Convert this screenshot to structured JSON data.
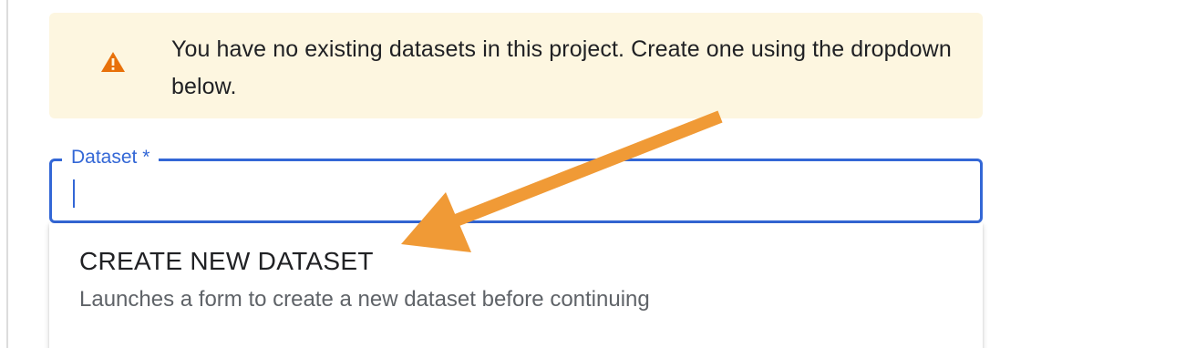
{
  "warning": {
    "icon": "warning-triangle-icon",
    "icon_color": "#e8710a",
    "background": "#fdf6e0",
    "message": "You have no existing datasets in this project. Create one using the dropdown below."
  },
  "dataset_field": {
    "label": "Dataset *",
    "value": "",
    "accent_color": "#3367d6"
  },
  "dropdown": {
    "options": [
      {
        "title": "CREATE NEW DATASET",
        "description": "Launches a form to create a new dataset before continuing"
      }
    ]
  },
  "annotation": {
    "icon": "arrow-icon",
    "color": "#f09a36"
  }
}
